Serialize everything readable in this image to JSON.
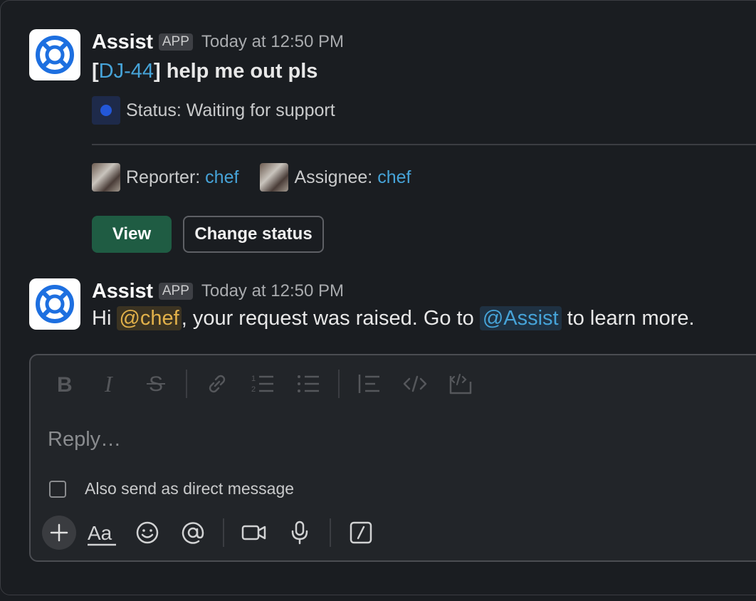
{
  "messages": [
    {
      "sender": "Assist",
      "badge": "APP",
      "timestamp": "Today at 12:50 PM",
      "title_prefix": "[",
      "ticket_id": "DJ-44",
      "title_suffix": "] help me out pls",
      "status_text": "Status: Waiting for support",
      "status_color": "#2357d8",
      "reporter_label": "Reporter: ",
      "reporter_value": "chef",
      "assignee_label": "Assignee: ",
      "assignee_value": "chef",
      "view_label": "View",
      "change_status_label": "Change status"
    },
    {
      "sender": "Assist",
      "badge": "APP",
      "timestamp": "Today at 12:50 PM",
      "text_pre": "Hi ",
      "mention_user": "@chef",
      "text_mid": ", your request was raised. Go to ",
      "mention_app": "@Assist",
      "text_post": " to learn more."
    }
  ],
  "composer": {
    "placeholder": "Reply…",
    "dm_label": "Also send as direct message",
    "dm_checked": false,
    "format_tools": [
      "bold-icon",
      "italic-icon",
      "strikethrough-icon",
      "link-icon",
      "ordered-list-icon",
      "bulleted-list-icon",
      "blockquote-icon",
      "code-icon",
      "code-block-icon"
    ],
    "actions": [
      "plus-icon",
      "formatting-icon",
      "emoji-icon",
      "mention-icon",
      "video-icon",
      "microphone-icon",
      "slash-command-icon"
    ],
    "formatting_glyph": "Aa"
  },
  "colors": {
    "accent_link": "#46a3d8",
    "primary_button": "#1f5c43",
    "mention_user": "#e2b14a",
    "app_icon": "#1d6fe0"
  }
}
